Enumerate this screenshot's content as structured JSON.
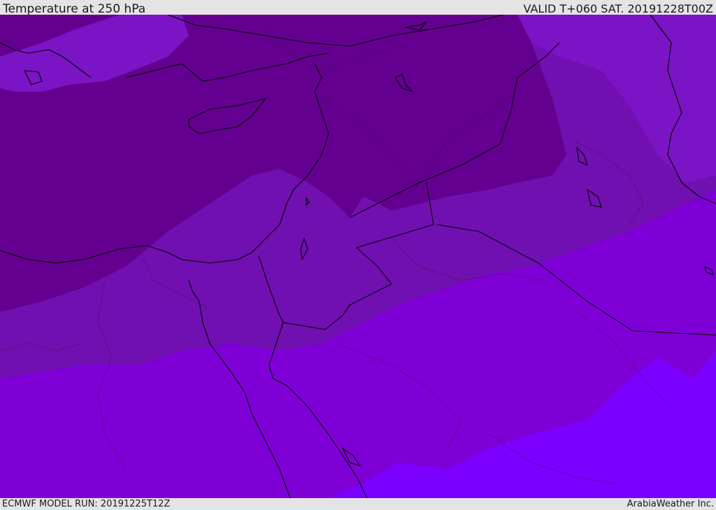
{
  "header": {
    "title": "Temperature at 250 hPa",
    "valid": "VALID T+060 SAT. 20191228T00Z"
  },
  "footer": {
    "model_run": "ECMWF MODEL RUN: 20191225T12Z",
    "credit": "ArabiaWeather Inc."
  },
  "colors": {
    "coldest_band": "#63008f",
    "cold_band": "#7010b0",
    "mid_band": "#7f00d6",
    "warm_band": "#7b00ff",
    "light_band": "#8a1cc9",
    "coastline": "#000000",
    "border": "#1a1a1a"
  }
}
